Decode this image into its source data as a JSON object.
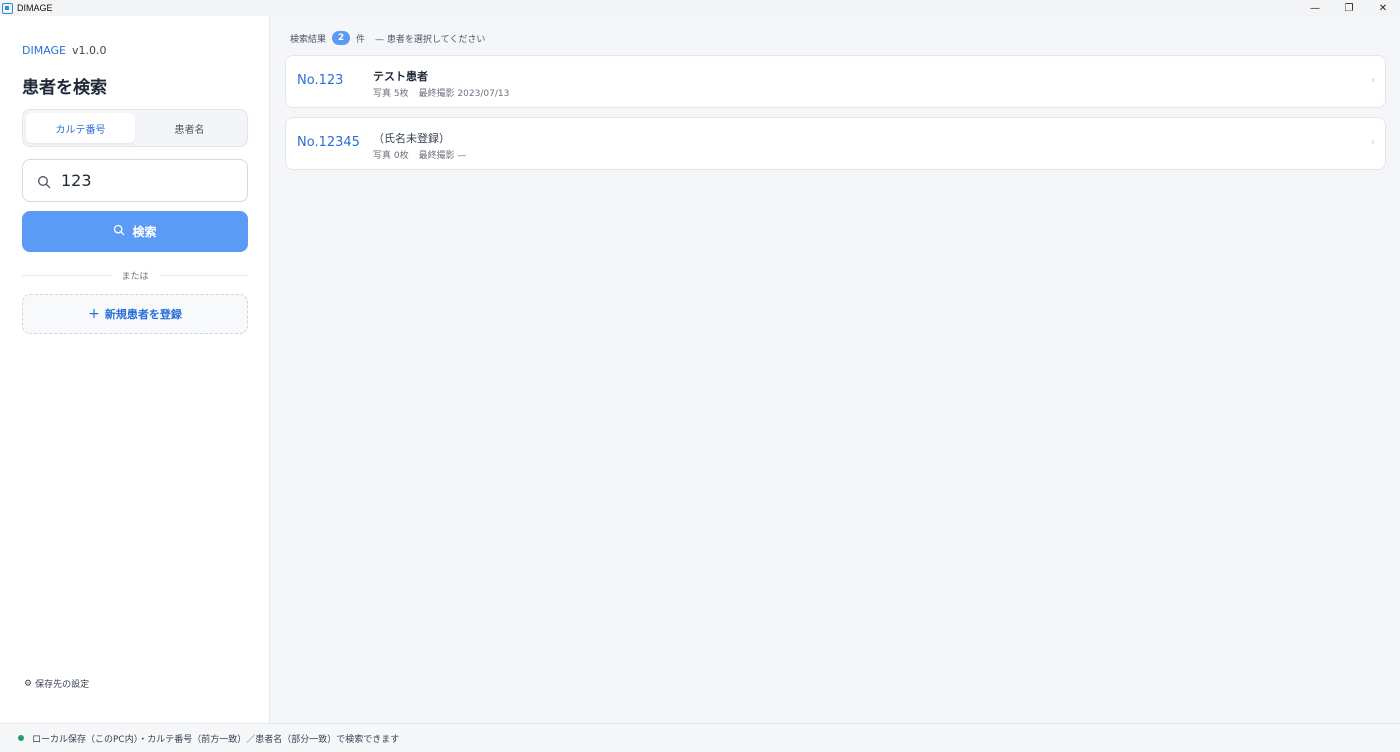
{
  "window": {
    "title": "DIMAGE",
    "controls": {
      "minimize": "—",
      "restore": "❐",
      "close": "✕"
    }
  },
  "sidebar": {
    "brand": "DIMAGE",
    "version": "v1.0.0",
    "title": "患者を検索",
    "tabs": [
      {
        "label": "カルテ番号",
        "active": true
      },
      {
        "label": "患者名",
        "active": false
      }
    ],
    "search_value": "123",
    "search_button": "検索",
    "divider_text": "または",
    "register_button": "新規患者を登録",
    "register_plus": "+",
    "settings_icon": "⚙",
    "settings_label": "保存先の設定"
  },
  "results": {
    "label": "検索結果",
    "count": "2",
    "unit": "件",
    "hint": "— 患者を選択してください",
    "items": [
      {
        "no": "No.123",
        "name": "テスト患者",
        "photos": "写真 5枚",
        "last_shot": "最終撮影 2023/07/13"
      },
      {
        "no": "No.12345",
        "name": "（氏名未登録）",
        "photos": "写真 0枚",
        "last_shot": "最終撮影 —"
      }
    ]
  },
  "status": {
    "text": "ローカル保存（このPC内）・カルテ番号（前方一致）／患者名（部分一致）で検索できます",
    "color": "#22a06b"
  },
  "colors": {
    "accent": "#2b6fd6",
    "button": "#5b9af5"
  }
}
